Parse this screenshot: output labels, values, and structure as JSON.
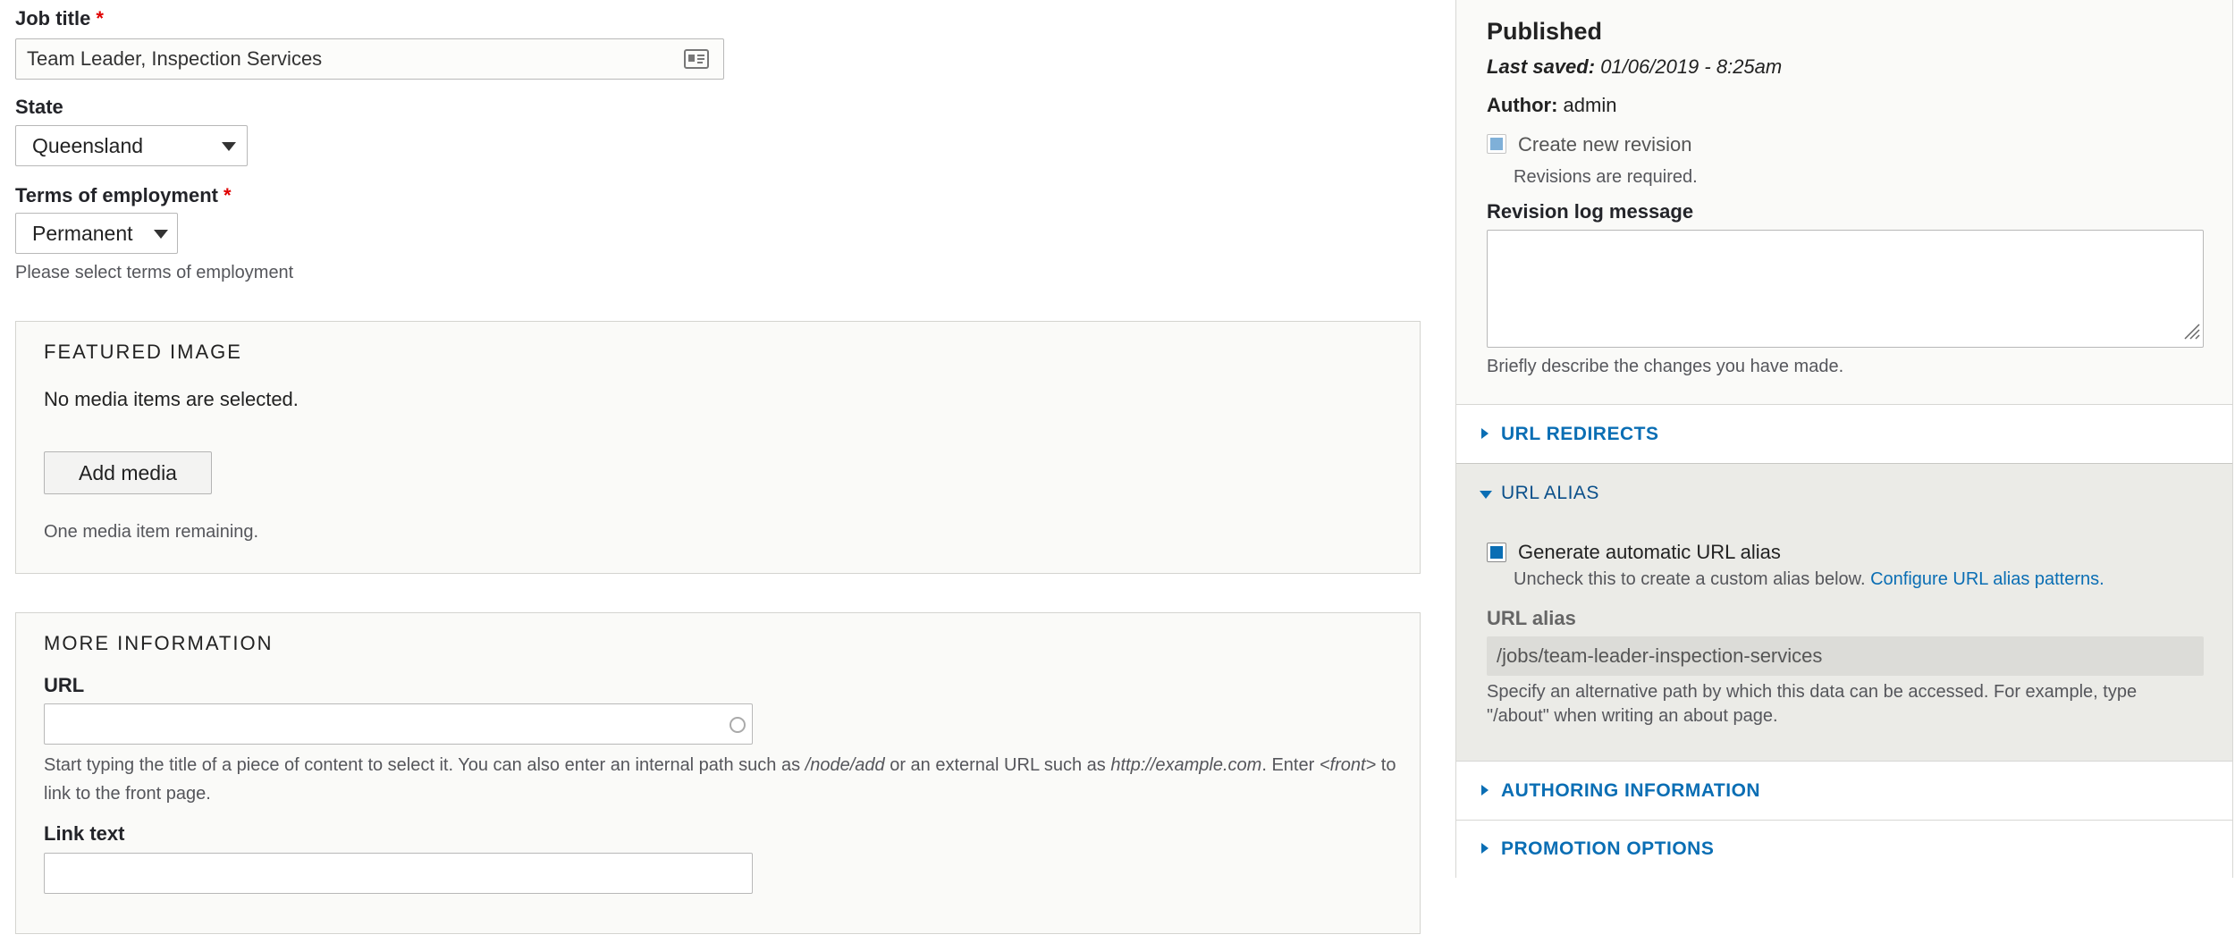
{
  "main": {
    "job_title": {
      "label": "Job title",
      "required_mark": "*",
      "value": "Team Leader, Inspection Services",
      "icon": "contact-card-icon"
    },
    "state": {
      "label": "State",
      "selected": "Queensland"
    },
    "terms": {
      "label": "Terms of employment",
      "required_mark": "*",
      "selected": "Permanent",
      "description": "Please select terms of employment"
    },
    "featured_image": {
      "legend": "FEATURED IMAGE",
      "empty_text": "No media items are selected.",
      "add_button": "Add media",
      "remaining": "One media item remaining."
    },
    "more_info": {
      "legend": "MORE INFORMATION",
      "url_label": "URL",
      "url_value": "",
      "url_desc_1": "Start typing the title of a piece of content to select it. You can also enter an internal path such as",
      "url_desc_path": "/node/add",
      "url_desc_2": "or an external URL such as",
      "url_desc_example": "http://example.com",
      "url_desc_3": ". Enter",
      "url_desc_front": "<front>",
      "url_desc_4": "to link to the front page.",
      "link_text_label": "Link text",
      "link_text_value": ""
    }
  },
  "sidebar": {
    "status": "Published",
    "last_saved_label": "Last saved:",
    "last_saved_value": "01/06/2019 - 8:25am",
    "author_label": "Author:",
    "author_value": "admin",
    "create_revision": {
      "label": "Create new revision",
      "checked": true,
      "note": "Revisions are required."
    },
    "revision_log": {
      "label": "Revision log message",
      "value": "",
      "description": "Briefly describe the changes you have made."
    },
    "url_redirects": "URL REDIRECTS",
    "url_alias": {
      "title": "URL ALIAS",
      "generate_label": "Generate automatic URL alias",
      "generate_checked": true,
      "uncheck_text": "Uncheck this to create a custom alias below.",
      "configure_link": "Configure URL alias patterns.",
      "alias_label": "URL alias",
      "alias_value": "/jobs/team-leader-inspection-services",
      "alias_desc_1": "Specify an alternative path by which this data can be accessed. For example, type",
      "alias_desc_2": "\"/about\" when writing an about page."
    },
    "authoring_info": "AUTHORING INFORMATION",
    "promotion_options": "PROMOTION OPTIONS"
  },
  "colors": {
    "accent": "#0a6eb4",
    "required": "#e00000",
    "checkbox_disabled": "#7fb0d8",
    "checkbox_checked": "#0a6eb4"
  }
}
